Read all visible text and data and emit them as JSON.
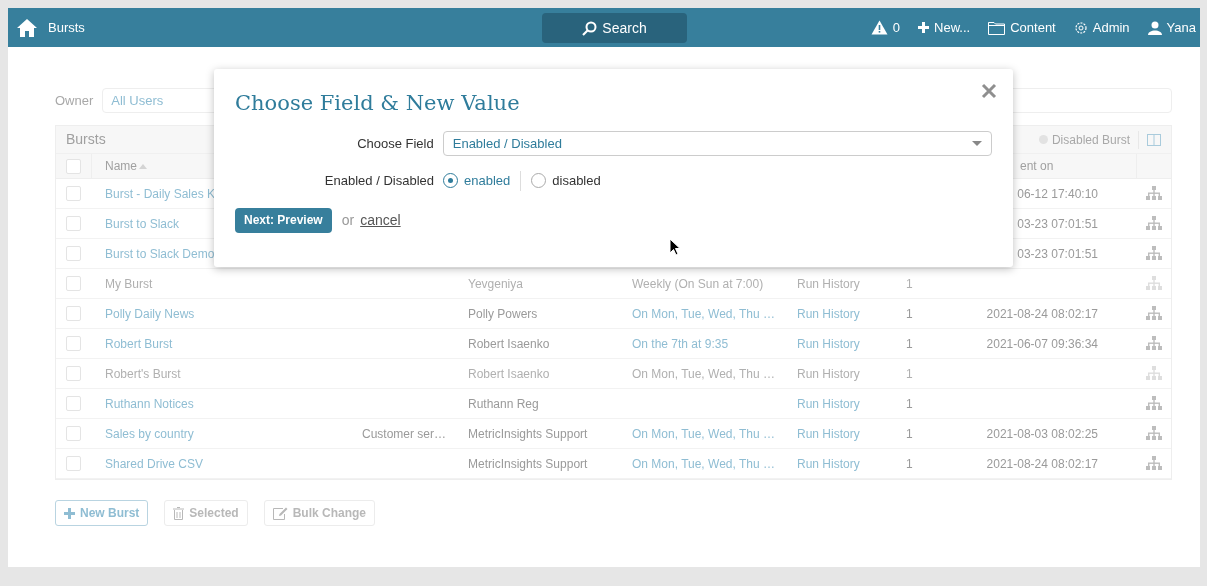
{
  "navbar": {
    "title": "Bursts",
    "search": "Search",
    "alerts": "0",
    "items": [
      "New...",
      "Content",
      "Admin",
      "Yana"
    ]
  },
  "filter": {
    "label": "Owner",
    "value": "All Users"
  },
  "table": {
    "title": "Bursts",
    "legend": "Disabled Burst",
    "columns": [
      "Name",
      "ent on"
    ],
    "all_checked": false,
    "rows": [
      {
        "name": "Burst - Daily Sales K",
        "sent_on": "06-12 17:40:10",
        "enabled": true,
        "checked": false
      },
      {
        "name": "Burst to Slack",
        "sent_on": "03-23 07:01:51",
        "enabled": true,
        "checked": false
      },
      {
        "name": "Burst to Slack Demo",
        "sent_on": "03-23 07:01:51",
        "enabled": true,
        "checked": false
      },
      {
        "name": "My Burst",
        "owner": "Yevgeniya",
        "schedule": "Weekly (On Sun at 7:00)",
        "history": "Run History",
        "count": "1",
        "enabled": false,
        "checked": false
      },
      {
        "name": "Polly Daily News",
        "owner": "Polly Powers",
        "schedule": "On Mon, Tue, Wed, Thu …",
        "history": "Run History",
        "count": "1",
        "sent_on": "2021-08-24 08:02:17",
        "enabled": true,
        "checked": false
      },
      {
        "name": "Robert Burst",
        "owner": "Robert Isaenko",
        "schedule": "On the 7th at 9:35",
        "history": "Run History",
        "count": "1",
        "sent_on": "2021-06-07 09:36:34",
        "enabled": true,
        "checked": false
      },
      {
        "name": "Robert's Burst",
        "owner": "Robert Isaenko",
        "schedule": "On Mon, Tue, Wed, Thu …",
        "history": "Run History",
        "count": "1",
        "enabled": false,
        "checked": false
      },
      {
        "name": "Ruthann Notices",
        "owner": "Ruthann Reg",
        "history": "Run History",
        "count": "1",
        "enabled": true,
        "checked": false
      },
      {
        "name": "Sales by country",
        "description": "Customer ser…",
        "owner": "MetricInsights Support",
        "schedule": "On Mon, Tue, Wed, Thu …",
        "history": "Run History",
        "count": "1",
        "sent_on": "2021-08-03 08:02:25",
        "enabled": true,
        "checked": false
      },
      {
        "name": "Shared Drive CSV",
        "owner": "MetricInsights Support",
        "schedule": "On Mon, Tue, Wed, Thu …",
        "history": "Run History",
        "count": "1",
        "sent_on": "2021-08-24 08:02:17",
        "enabled": true,
        "checked": false
      }
    ]
  },
  "actions": [
    {
      "label": "New Burst",
      "kind": "add",
      "disabled": false
    },
    {
      "label": "Selected",
      "kind": "delete",
      "disabled": true
    },
    {
      "label": "Bulk Change",
      "kind": "edit",
      "disabled": true
    }
  ],
  "dialog": {
    "title": "Choose Field & New Value",
    "field_label": "Choose Field",
    "field_value": "Enabled / Disabled",
    "radio_label": "Enabled / Disabled",
    "options": [
      {
        "label": "enabled",
        "selected": true
      },
      {
        "label": "disabled",
        "selected": false
      }
    ],
    "primary": "Next: Preview",
    "or": "or",
    "cancel": "cancel"
  }
}
